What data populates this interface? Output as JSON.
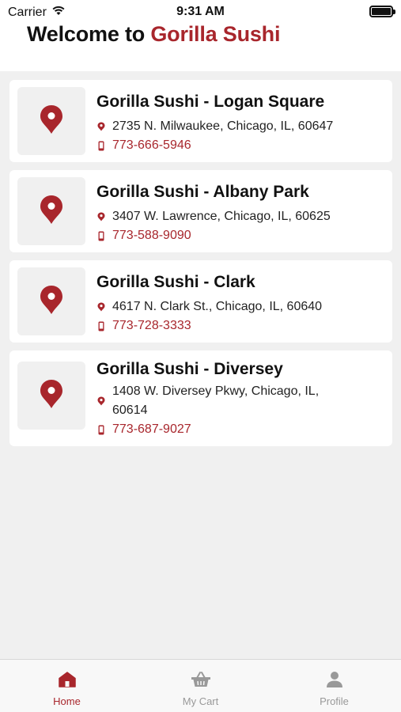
{
  "status_bar": {
    "carrier": "Carrier",
    "time": "9:31 AM"
  },
  "header": {
    "title_prefix": "Welcome to ",
    "title_brand": "Gorilla Sushi"
  },
  "locations": [
    {
      "name": "Gorilla Sushi - Logan Square",
      "address": "2735 N. Milwaukee, Chicago, IL, 60647",
      "phone": "773-666-5946"
    },
    {
      "name": "Gorilla Sushi - Albany Park",
      "address": "3407 W. Lawrence, Chicago, IL, 60625",
      "phone": "773-588-9090"
    },
    {
      "name": "Gorilla Sushi - Clark",
      "address": "4617 N. Clark St., Chicago, IL, 60640",
      "phone": "773-728-3333"
    },
    {
      "name": "Gorilla Sushi - Diversey",
      "address": "1408 W. Diversey Pkwy, Chicago, IL, 60614",
      "phone": "773-687-9027"
    }
  ],
  "tabs": [
    {
      "label": "Home",
      "icon": "home-icon",
      "active": true
    },
    {
      "label": "My Cart",
      "icon": "basket-icon",
      "active": false
    },
    {
      "label": "Profile",
      "icon": "person-icon",
      "active": false
    }
  ],
  "colors": {
    "accent": "#a8262c",
    "background": "#f0f0f0",
    "inactive_tab": "#999999"
  }
}
